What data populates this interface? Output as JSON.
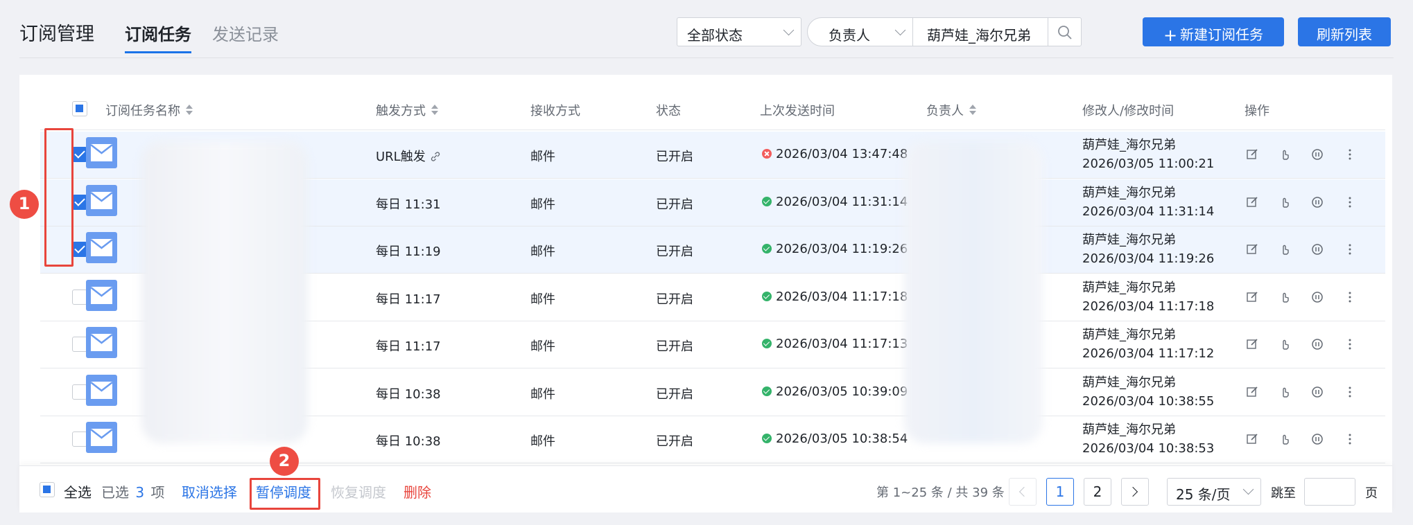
{
  "header": {
    "title": "订阅管理",
    "tabs": [
      {
        "label": "订阅任务"
      },
      {
        "label": "发送记录"
      }
    ],
    "status_filter": "全部状态",
    "owner_filter": "负责人",
    "owner_value": "葫芦娃_海尔兄弟",
    "new_button": "新建订阅任务",
    "refresh_button": "刷新列表"
  },
  "table": {
    "columns": [
      "订阅任务名称",
      "触发方式",
      "接收方式",
      "状态",
      "上次发送时间",
      "负责人",
      "修改人/修改时间",
      "操作"
    ],
    "rows": [
      {
        "checked": true,
        "trigger": "URL触发",
        "receive": "邮件",
        "status": "已开启",
        "last_sent": "2026/03/04 13:47:48",
        "last_ok": false,
        "modifier": "葫芦娃_海尔兄弟",
        "modified": "2026/03/05 11:00:21"
      },
      {
        "checked": true,
        "trigger": "每日 11:31",
        "receive": "邮件",
        "status": "已开启",
        "last_sent": "2026/03/04 11:31:14",
        "last_ok": true,
        "modifier": "葫芦娃_海尔兄弟",
        "modified": "2026/03/04 11:31:14"
      },
      {
        "checked": true,
        "trigger": "每日 11:19",
        "receive": "邮件",
        "status": "已开启",
        "last_sent": "2026/03/04 11:19:26",
        "last_ok": true,
        "modifier": "葫芦娃_海尔兄弟",
        "modified": "2026/03/04 11:19:26"
      },
      {
        "checked": false,
        "trigger": "每日 11:17",
        "receive": "邮件",
        "status": "已开启",
        "last_sent": "2026/03/04 11:17:18",
        "last_ok": true,
        "modifier": "葫芦娃_海尔兄弟",
        "modified": "2026/03/04 11:17:18"
      },
      {
        "checked": false,
        "trigger": "每日 11:17",
        "receive": "邮件",
        "status": "已开启",
        "last_sent": "2026/03/04 11:17:13",
        "last_ok": true,
        "modifier": "葫芦娃_海尔兄弟",
        "modified": "2026/03/04 11:17:12"
      },
      {
        "checked": false,
        "trigger": "每日 10:38",
        "receive": "邮件",
        "status": "已开启",
        "last_sent": "2026/03/05 10:39:09",
        "last_ok": true,
        "modifier": "葫芦娃_海尔兄弟",
        "modified": "2026/03/04 10:38:55"
      },
      {
        "checked": false,
        "trigger": "每日 10:38",
        "receive": "邮件",
        "status": "已开启",
        "last_sent": "2026/03/05 10:38:54",
        "last_ok": true,
        "modifier": "葫芦娃_海尔兄弟",
        "modified": "2026/03/04 10:38:53"
      }
    ]
  },
  "footer": {
    "select_all": "全选",
    "selected_prefix": "已选",
    "selected_count": "3",
    "selected_suffix": "项",
    "cancel_select": "取消选择",
    "pause": "暂停调度",
    "resume": "恢复调度",
    "delete": "删除",
    "range": "第 1~25 条 / 共 39 条",
    "pages": [
      "1",
      "2"
    ],
    "page_size": "25 条/页",
    "jump_label": "跳至",
    "page_label": "页"
  },
  "annotations": [
    "1",
    "2"
  ],
  "colors": {
    "accent": "#2b75e6",
    "danger": "#e8453c",
    "success": "#34b36a",
    "mail_icon": "#6a9cf0"
  }
}
